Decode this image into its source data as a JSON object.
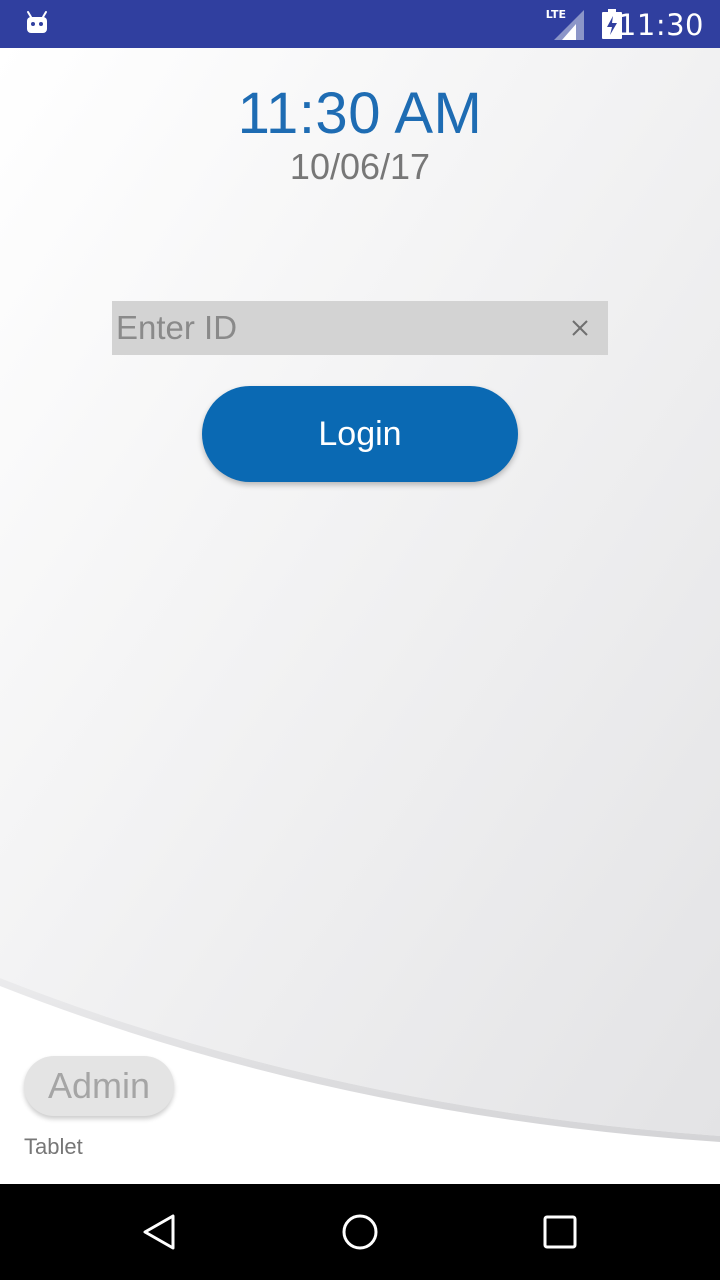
{
  "status_bar": {
    "network_type": "LTE",
    "clock": "11:30",
    "icons": [
      "android-debug-icon",
      "signal-icon",
      "battery-charging-icon"
    ]
  },
  "main": {
    "time": "11:30 AM",
    "date": "10/06/17",
    "id_input": {
      "placeholder": "Enter ID",
      "value": ""
    },
    "login_label": "Login",
    "admin_label": "Admin",
    "device_label": "Tablet"
  },
  "nav_bar": {
    "icons": [
      "back-icon",
      "home-icon",
      "recent-apps-icon"
    ]
  },
  "colors": {
    "status_bar": "#303f9f",
    "accent_blue": "#0a69b3",
    "time_text": "#1e6cb3",
    "field_bg": "#d3d3d3"
  }
}
